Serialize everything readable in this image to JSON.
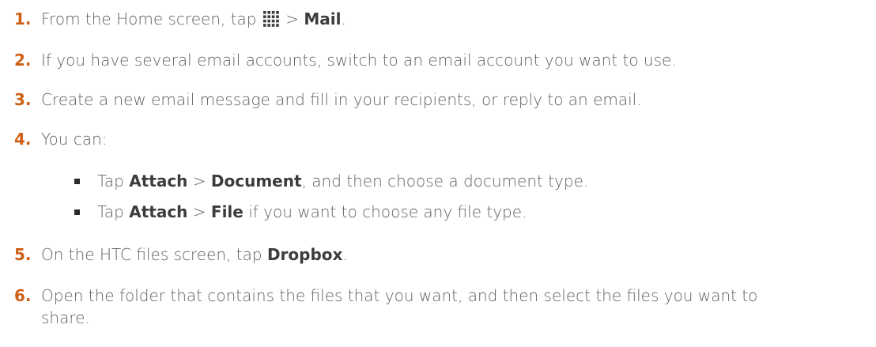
{
  "steps": [
    {
      "num": "1.",
      "a": "From the Home screen, tap ",
      "icon": "apps-grid-icon",
      "b": " > ",
      "c": "Mail",
      "d": "."
    },
    {
      "num": "2.",
      "text": "If you have several email accounts, switch to an email account you want to use."
    },
    {
      "num": "3.",
      "text": "Create a new email message and fill in your recipients, or reply to an email."
    },
    {
      "num": "4.",
      "text": "You can:"
    },
    {
      "num": "5.",
      "a": "On the HTC files screen, tap ",
      "b": "Dropbox",
      "c": "."
    },
    {
      "num": "6.",
      "text": "Open the folder that contains the files that you want, and then select the files you want to share."
    }
  ],
  "sub_items": [
    {
      "a": "Tap ",
      "b": "Attach",
      "c": " > ",
      "d": "Document",
      "e": ", and then choose a document type."
    },
    {
      "a": "Tap ",
      "b": "Attach",
      "c": " > ",
      "d": "File",
      "e": " if you want to choose any file type."
    }
  ]
}
